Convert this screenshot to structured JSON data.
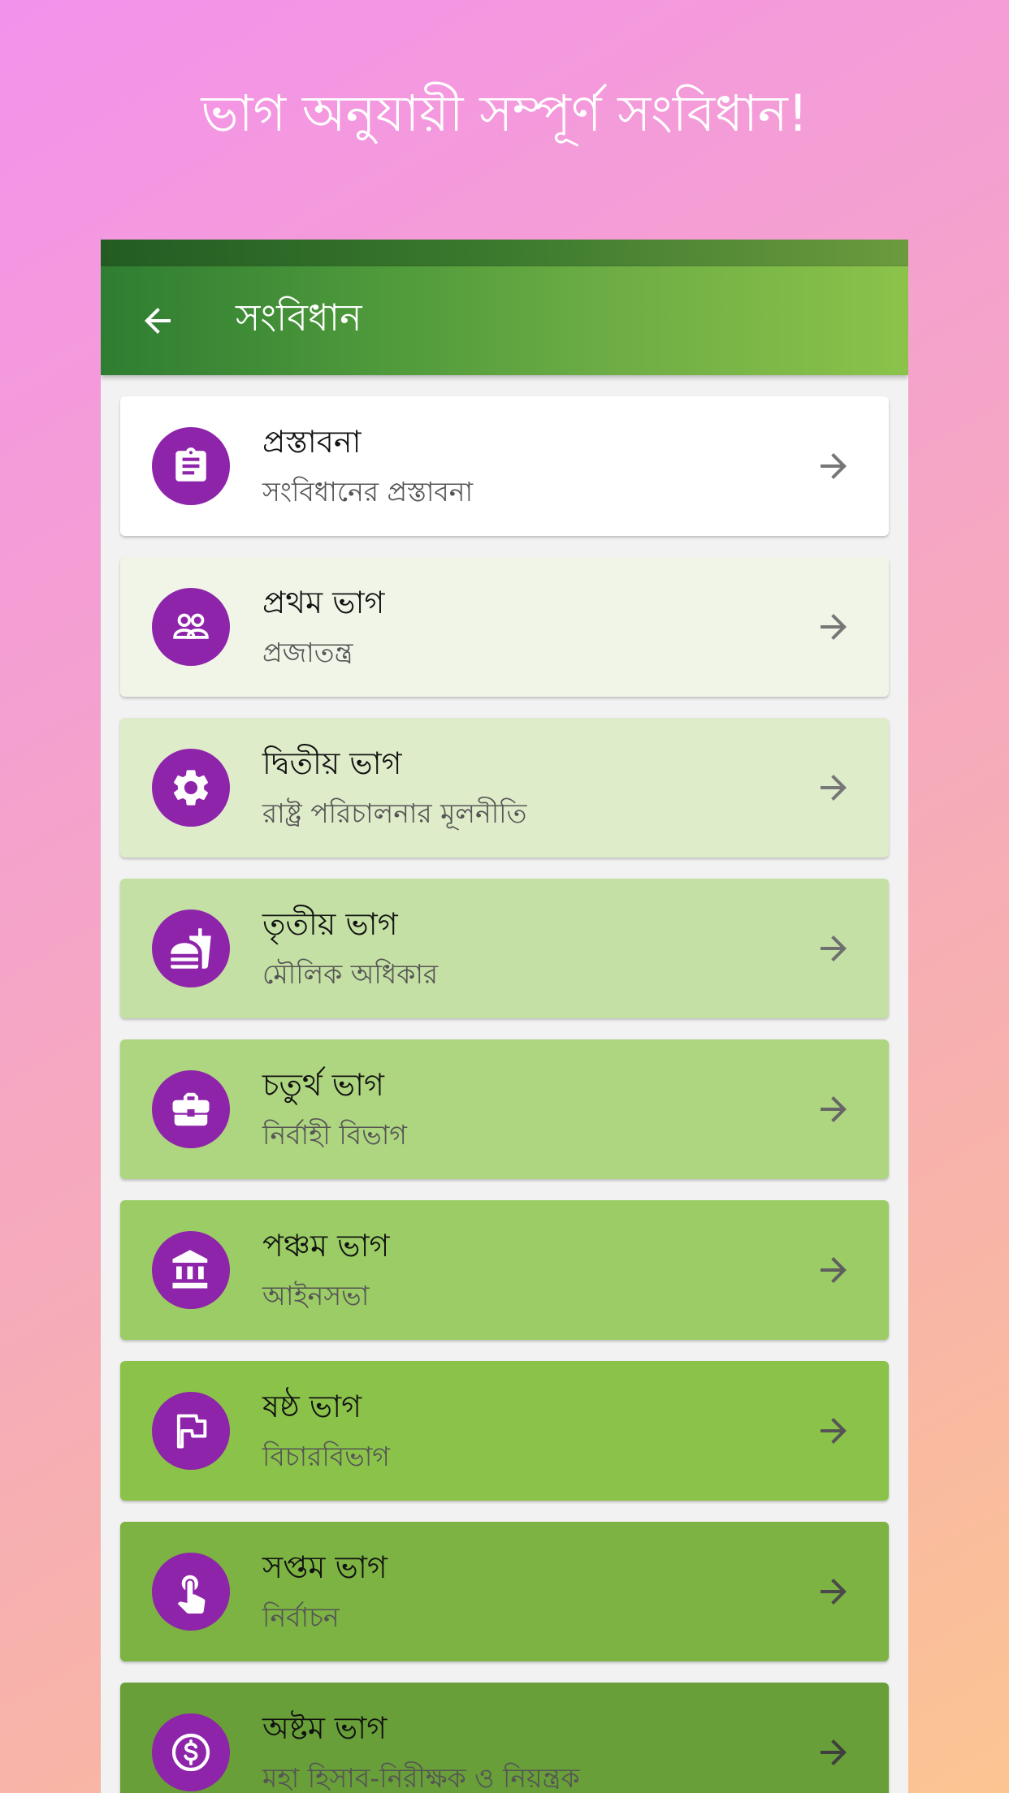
{
  "headline": "ভাগ অনুযায়ী সম্পূর্ণ সংবিধান!",
  "appbar": {
    "title": "সংবিধান"
  },
  "parts": [
    {
      "title": "প্রস্তাবনা",
      "subtitle": "সংবিধানের প্রস্তাবনা",
      "icon": "clipboard-icon",
      "bg": "#ffffff"
    },
    {
      "title": "প্রথম ভাগ",
      "subtitle": "প্রজাতন্ত্র",
      "icon": "people-icon",
      "bg": "#f0f5e8"
    },
    {
      "title": "দ্বিতীয় ভাগ",
      "subtitle": "রাষ্ট্র পরিচালনার মূলনীতি",
      "icon": "gear-icon",
      "bg": "#dfecca"
    },
    {
      "title": "তৃতীয় ভাগ",
      "subtitle": "মৌলিক অধিকার",
      "icon": "fastfood-icon",
      "bg": "#c5e0a5"
    },
    {
      "title": "চতুর্থ ভাগ",
      "subtitle": "নির্বাহী বিভাগ",
      "icon": "briefcase-icon",
      "bg": "#aed580"
    },
    {
      "title": "পঞ্চম ভাগ",
      "subtitle": "আইনসভা",
      "icon": "bank-icon",
      "bg": "#9ccc65"
    },
    {
      "title": "ষষ্ঠ ভাগ",
      "subtitle": "বিচারবিভাগ",
      "icon": "flag-icon",
      "bg": "#8bc34a"
    },
    {
      "title": "সপ্তম ভাগ",
      "subtitle": "নির্বাচন",
      "icon": "touch-icon",
      "bg": "#7cb342"
    },
    {
      "title": "অষ্টম ভাগ",
      "subtitle": "মহা হিসাব-নিরীক্ষক ও নিয়ন্ত্রক",
      "icon": "dollar-icon",
      "bg": "#689f38"
    }
  ]
}
